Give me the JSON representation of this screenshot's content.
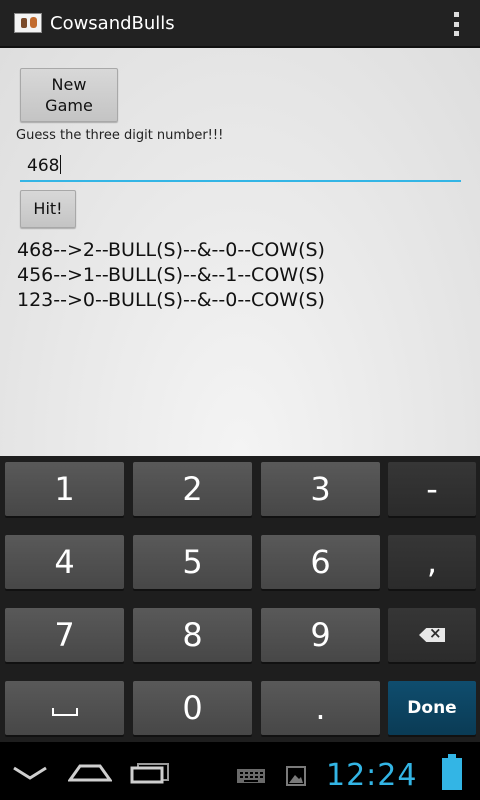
{
  "actionbar": {
    "title": "CowsandBulls",
    "icon": "cows-bulls-app-icon",
    "overflow_icon": "overflow-menu-icon"
  },
  "main": {
    "new_game_label": "New\nGame",
    "prompt": "Guess the three digit number!!!",
    "guess_value": "468",
    "hit_label": "Hit!",
    "history": [
      "468-->2--BULL(S)--&--0--COW(S)",
      "456-->1--BULL(S)--&--1--COW(S)",
      "123-->0--BULL(S)--&--0--COW(S)"
    ]
  },
  "keyboard": {
    "keys": [
      "1",
      "2",
      "3",
      "-",
      "4",
      "5",
      "6",
      ",",
      "7",
      "8",
      "9",
      "0",
      ".",
      "Done"
    ],
    "space_icon": "space-icon",
    "backspace_icon": "backspace-icon"
  },
  "statusbar": {
    "time": "12:24"
  },
  "colors": {
    "accent": "#33b5e5",
    "action_bar": "#222222",
    "keyboard": "#1e1e1e",
    "done_key": "#0f4d6e"
  }
}
